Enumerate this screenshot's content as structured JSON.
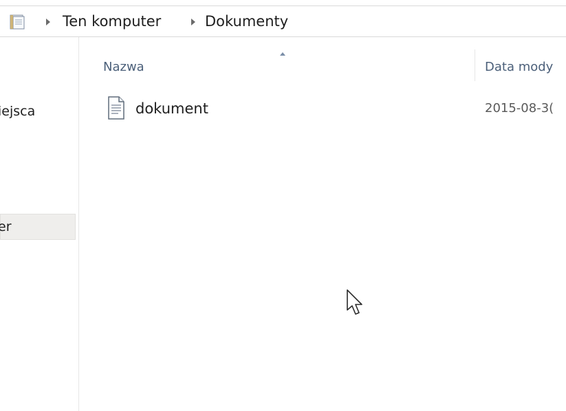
{
  "address_bar": {
    "icon": "documents-folder-icon",
    "breadcrumbs": [
      "Ten komputer",
      "Dokumenty"
    ]
  },
  "nav_pane": {
    "items": [
      {
        "label": "iejsca"
      },
      {
        "label": "er",
        "selected": true
      }
    ]
  },
  "file_list": {
    "columns": [
      "Nazwa",
      "Data mody"
    ],
    "sort_column": "Nazwa",
    "rows": [
      {
        "name": "dokument",
        "date": "2015-08-3(",
        "icon": "text-document-icon"
      }
    ]
  },
  "cursor": "mouse-pointer-icon"
}
